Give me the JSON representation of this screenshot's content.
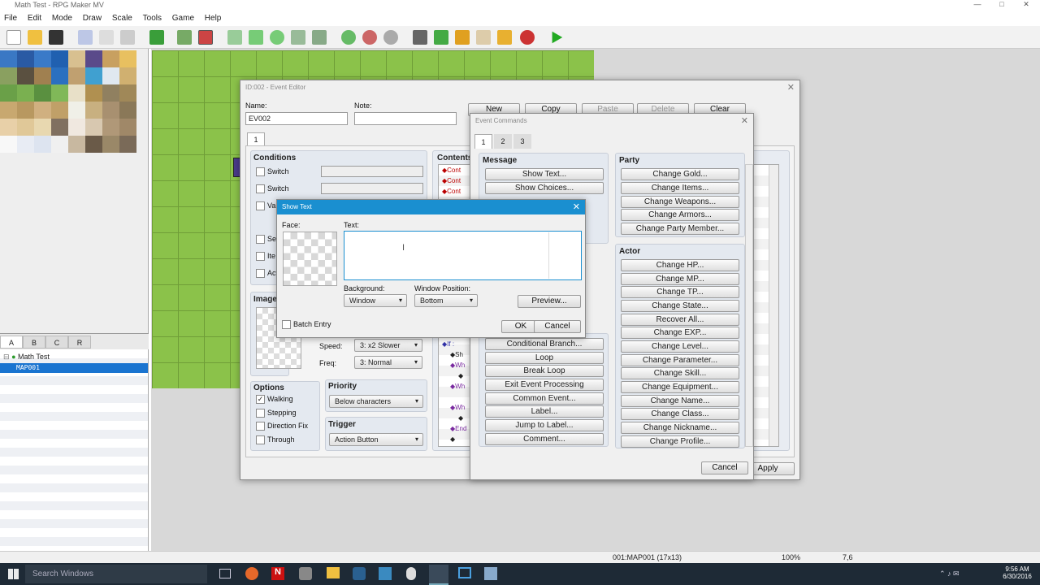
{
  "app": {
    "title": "Math Test - RPG Maker MV"
  },
  "menu": [
    "File",
    "Edit",
    "Mode",
    "Draw",
    "Scale",
    "Tools",
    "Game",
    "Help"
  ],
  "tileset_tabs": [
    "A",
    "B",
    "C",
    "R"
  ],
  "tree": {
    "root": "Math Test",
    "map": "MAP001"
  },
  "status": {
    "map_info": "001:MAP001 (17x13)",
    "zoom": "100%",
    "coords": "7,6"
  },
  "taskbar": {
    "search": "Search Windows",
    "time": "9:56 AM",
    "date": "6/30/2016"
  },
  "event_editor": {
    "title": "ID:002 - Event Editor",
    "name_label": "Name:",
    "name_value": "EV002",
    "note_label": "Note:",
    "note_value": "",
    "page_buttons": [
      "New",
      "Copy",
      "Paste",
      "Delete",
      "Clear"
    ],
    "page_tab": "1",
    "conditions_title": "Conditions",
    "conditions": [
      "Switch",
      "Switch",
      "Var",
      "Sel",
      "Ite",
      "Act"
    ],
    "contents_title": "Contents",
    "image_title": "Image",
    "speed_label": "Speed:",
    "speed_value": "3: x2 Slower",
    "freq_label": "Freq:",
    "freq_value": "3: Normal",
    "options_title": "Options",
    "options": [
      {
        "label": "Walking",
        "checked": true
      },
      {
        "label": "Stepping",
        "checked": false
      },
      {
        "label": "Direction Fix",
        "checked": false
      },
      {
        "label": "Through",
        "checked": false
      }
    ],
    "priority_title": "Priority",
    "priority_value": "Below characters",
    "trigger_title": "Trigger",
    "trigger_value": "Action Button",
    "apply_label": "Apply",
    "contents_lines": [
      "◆Cont",
      "◆Cont",
      "◆Cont",
      "◆If :",
      "◆Sh",
      "◆Wh",
      "◆",
      "◆Wh",
      "◆Wh",
      "◆",
      "◆End",
      "◆"
    ]
  },
  "event_commands": {
    "title": "Event Commands",
    "tabs": [
      "1",
      "2",
      "3"
    ],
    "message_title": "Message",
    "message": [
      "Show Text...",
      "Show Choices..."
    ],
    "flow": [
      "Conditional Branch...",
      "Loop",
      "Break Loop",
      "Exit Event Processing",
      "Common Event...",
      "Label...",
      "Jump to Label...",
      "Comment..."
    ],
    "party_title": "Party",
    "party": [
      "Change Gold...",
      "Change Items...",
      "Change Weapons...",
      "Change Armors...",
      "Change Party Member..."
    ],
    "actor_title": "Actor",
    "actor": [
      "Change HP...",
      "Change MP...",
      "Change TP...",
      "Change State...",
      "Recover All...",
      "Change EXP...",
      "Change Level...",
      "Change Parameter...",
      "Change Skill...",
      "Change Equipment...",
      "Change Name...",
      "Change Class...",
      "Change Nickname...",
      "Change Profile..."
    ],
    "cancel_label": "Cancel"
  },
  "show_text": {
    "title": "Show Text",
    "face_label": "Face:",
    "text_label": "Text:",
    "text_value": "",
    "background_label": "Background:",
    "background_value": "Window",
    "position_label": "Window Position:",
    "position_value": "Bottom",
    "preview_label": "Preview...",
    "batch_label": "Batch Entry",
    "ok_label": "OK",
    "cancel_label": "Cancel"
  },
  "colors": {
    "accent": "#1a8fd0",
    "grass": "#8bc24a",
    "taskbar": "#1e2a36"
  }
}
